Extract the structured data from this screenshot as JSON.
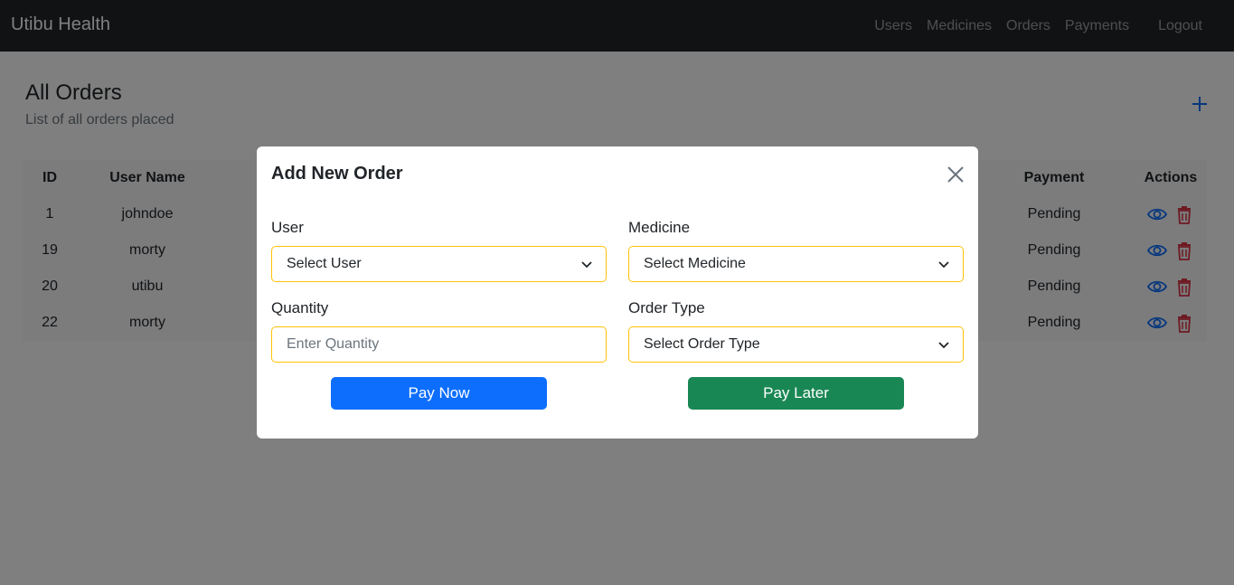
{
  "navbar": {
    "brand": "Utibu Health",
    "links": [
      "Users",
      "Medicines",
      "Orders",
      "Payments"
    ],
    "logout": "Logout"
  },
  "page": {
    "title": "All Orders",
    "subtitle": "List of all orders placed",
    "add_icon": "plus-icon"
  },
  "table": {
    "headers": {
      "id": "ID",
      "user_name": "User Name",
      "payment": "Payment",
      "actions": "Actions"
    },
    "rows": [
      {
        "id": "1",
        "user_name": "johndoe",
        "payment": "Pending"
      },
      {
        "id": "19",
        "user_name": "morty",
        "payment": "Pending"
      },
      {
        "id": "20",
        "user_name": "utibu",
        "payment": "Pending"
      },
      {
        "id": "22",
        "user_name": "morty",
        "payment": "Pending"
      }
    ],
    "action_icons": [
      "eye-icon",
      "trash-icon"
    ]
  },
  "modal": {
    "title": "Add New Order",
    "user_label": "User",
    "user_select": "Select User",
    "medicine_label": "Medicine",
    "medicine_select": "Select Medicine",
    "quantity_label": "Quantity",
    "quantity_placeholder": "Enter Quantity",
    "order_type_label": "Order Type",
    "order_type_select": "Select Order Type",
    "pay_now": "Pay Now",
    "pay_later": "Pay Later"
  },
  "colors": {
    "navbar_bg": "#212529",
    "primary": "#0d6efd",
    "success": "#198754",
    "danger": "#dc3545",
    "field_border": "#ffc107"
  }
}
